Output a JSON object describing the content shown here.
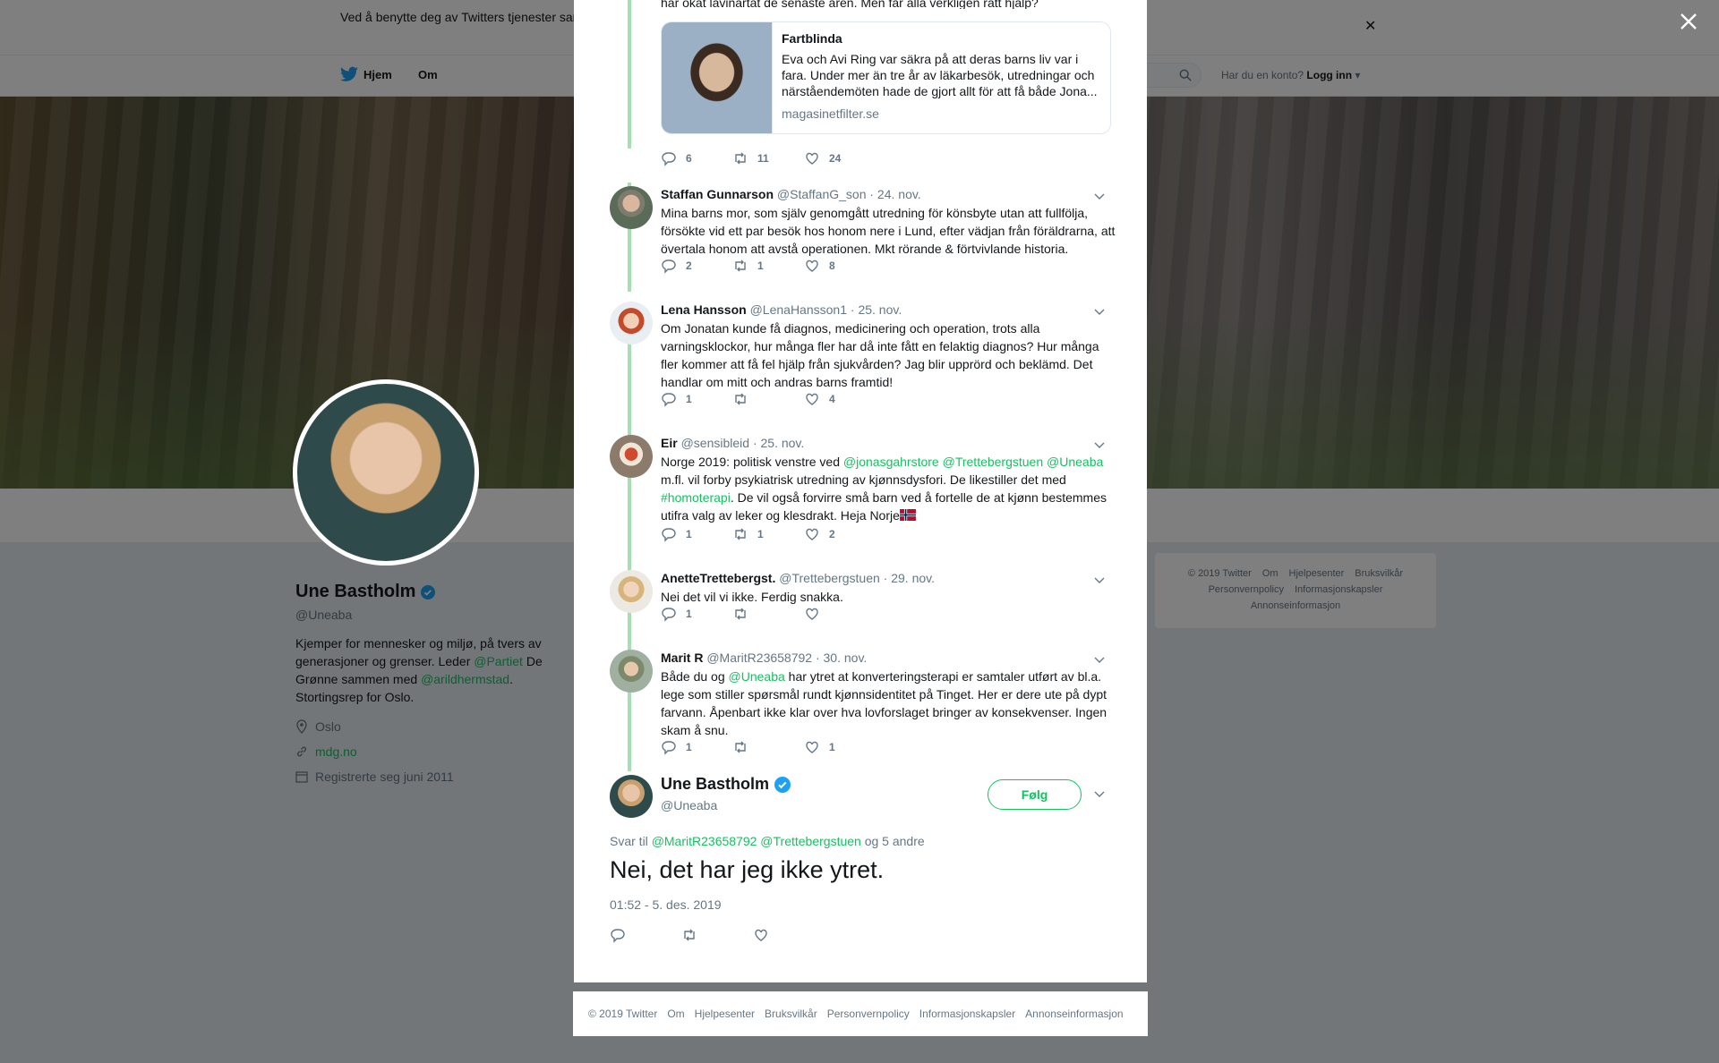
{
  "cookie": {
    "text": "Ved å benytte deg av Twitters tjenester samtykker du i at vi kan benytte informasjonskapsler til bl.a. analyser, personalisering og annonser."
  },
  "topnav": {
    "home": "Hjem",
    "about": "Om",
    "login_q": "Har du en konto?",
    "login": "Logg inn"
  },
  "profile": {
    "name": "Une Bastholm",
    "handle": "@Uneaba",
    "bio_1": "Kjemper for mennesker og miljø, på tvers av generasjoner og grenser. Leder ",
    "bio_link_1": "@Partiet",
    "bio_2": " De Grønne sammen med ",
    "bio_link_2": "@arildhermstad",
    "bio_3": ". Stortingsrep for Oslo.",
    "location": "Oslo",
    "url": "mdg.no",
    "joined": "Registrerte seg juni 2011"
  },
  "side_footer": [
    "© 2019 Twitter",
    "Om",
    "Hjelpesenter",
    "Bruksvilkår",
    "Personvernpolicy",
    "Informasjonskapsler",
    "Annonseinformasjon"
  ],
  "thread": {
    "top_snippet": "har ökat lavinartat de senaste åren. Men får alla verkligen rätt hjälp?",
    "card": {
      "title": "Fartblinda",
      "description": "Eva och Avi Ring var säkra på att deras barns liv var i fara. Under mer än tre år av läkarbesök, utredningar och närståendemöten hade de gjort allt för att få både Jona...",
      "domain": "magasinetfilter.se"
    },
    "top_actions": {
      "replies": "6",
      "retweets": "11",
      "likes": "24"
    },
    "tweets": [
      {
        "name": "Staffan Gunnarson",
        "handle": "@StaffanG_son",
        "date": "· 24. nov.",
        "text": "Mina barns mor, som själv genomgått utredning för könsbyte utan att fullfölja, försökte vid ett par besök hos honom nere i Lund, efter vädjan från föräldrarna, att övertala honom att avstå operationen. Mkt rörande & förtvivlande historia.",
        "replies": "2",
        "retweets": "1",
        "likes": "8"
      },
      {
        "name": "Lena Hansson",
        "handle": "@LenaHansson1",
        "date": "· 25. nov.",
        "text": "Om Jonatan kunde få diagnos, medicinering och operation, trots alla varningsklockor, hur många fler har då inte fått en felaktig diagnos? Hur många fler kommer att få fel hjälp från sjukvården? Jag blir upprörd och beklämd. Det handlar om mitt och andras barns framtid!",
        "replies": "1",
        "retweets": "",
        "likes": "4"
      },
      {
        "name": "Eir",
        "handle": "@sensibleid",
        "date": "· 25. nov.",
        "text_1": "Norge 2019: politisk venstre ved ",
        "link_1": "@jonasgahrstore @Trettebergstuen @Uneaba",
        "text_2": " m.fl. vil forby psykiatrisk utredning av kjønnsdysfori. De likestiller det med ",
        "link_2": "#homoterapi",
        "text_3": ". De vil også forvirre små barn ved å fortelle de at kjønn bestemmes utifra valg av leker og klesdrakt. Heja Norje",
        "replies": "1",
        "retweets": "1",
        "likes": "2"
      },
      {
        "name": "AnetteTrettebergst.",
        "handle": "@Trettebergstuen",
        "date": "· 29. nov.",
        "text": "Nei det vil vi ikke. Ferdig snakka.",
        "replies": "1",
        "retweets": "",
        "likes": ""
      },
      {
        "name": "Marit R",
        "handle": "@MaritR23658792",
        "date": "· 30. nov.",
        "text_1": "Både du og ",
        "link_1": "@Uneaba",
        "text_2": "  har ytret at konverteringsterapi er samtaler utført av bl.a. lege som stiller spørsmål rundt kjønnsidentitet på Tinget. Her er dere ute på dypt farvann. Åpenbart ikke klar over hva lovforslaget bringer av konsekvenser. Ingen skam å snu.",
        "replies": "1",
        "retweets": "",
        "likes": "1"
      }
    ],
    "main": {
      "name": "Une Bastholm",
      "handle": "@Uneaba",
      "follow": "Følg",
      "reply_prefix": "Svar til ",
      "reply_links": "@MaritR23658792 @Trettebergstuen",
      "reply_suffix": " og 5 andre",
      "text": "Nei, det har jeg ikke ytret.",
      "timestamp": "01:52 - 5. des. 2019"
    }
  },
  "modal_footer": [
    "© 2019 Twitter",
    "Om",
    "Hjelpesenter",
    "Bruksvilkår",
    "Personvernpolicy",
    "Informasjonskapsler",
    "Annonseinformasjon"
  ],
  "colors": {
    "accent": "#17bf63",
    "thread_line": "#a8deb6",
    "verified": "#1da1f2"
  }
}
